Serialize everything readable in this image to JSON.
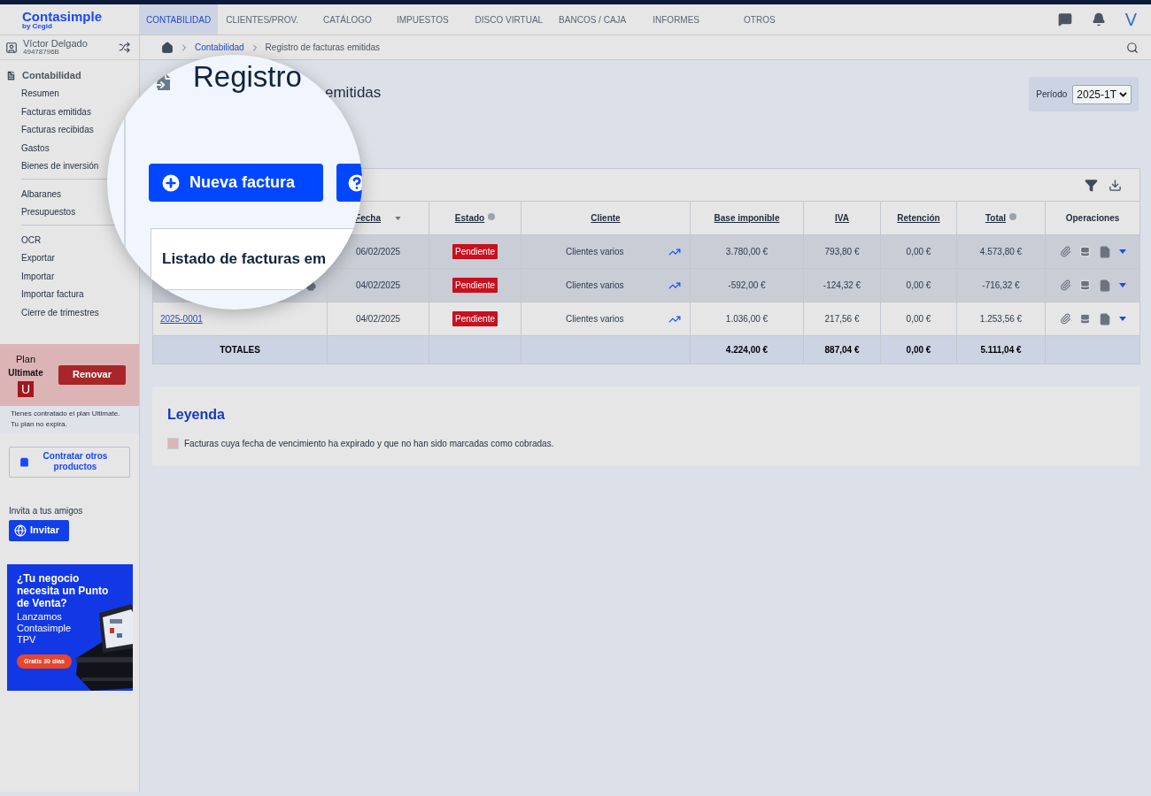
{
  "app": {
    "logo": "Contasimple",
    "logo_sub": "by Cegid",
    "user_initial": "V"
  },
  "nav": [
    {
      "label": "CONTABILIDAD",
      "selected": true
    },
    {
      "label": "CLIENTES/PROV.",
      "selected": false
    },
    {
      "label": "CATÁLOGO",
      "selected": false
    },
    {
      "label": "IMPUESTOS",
      "selected": false
    },
    {
      "label": "DISCO VIRTUAL",
      "selected": false
    },
    {
      "label": "BANCOS / CAJA",
      "selected": false
    },
    {
      "label": "INFORMES",
      "selected": false
    },
    {
      "label": "OTROS",
      "selected": false
    }
  ],
  "user": {
    "name": "Víctor Delgado",
    "id": "49478796B"
  },
  "breadcrumb": [
    "Contabilidad",
    "Registro de facturas emitidas"
  ],
  "sidebar": {
    "section": "Contabilidad",
    "groups": [
      [
        "Resumen",
        "Facturas emitidas",
        "Facturas recibidas",
        "Gastos",
        "Bienes de inversión"
      ],
      [
        "Albaranes",
        "Presupuestos"
      ],
      [
        "OCR",
        "Exportar",
        "Importar",
        "Importar factura",
        "Cierre de trimestres"
      ]
    ]
  },
  "plan": {
    "label": "Plan",
    "name": "Ultimate",
    "badge": "U",
    "button": "Renovar",
    "note": [
      "Tienes contratado el plan Ultimate.",
      "Tu plan no expira."
    ]
  },
  "other_products_button": "Contratar otros productos",
  "invite": {
    "label": "Invita a tus amigos",
    "button": "Invitar"
  },
  "promo": {
    "headline": "¿Tu negocio necesita un Punto de Venta?",
    "text": "Lanzamos Contasimple TPV",
    "badge": "Gratis 30 días"
  },
  "page": {
    "title_visible": "emitidas",
    "period_label": "Período",
    "period_value": "2025-1T"
  },
  "magnifier": {
    "title": "Registro",
    "button": "Nueva factura",
    "card_title": "Listado de facturas em"
  },
  "table": {
    "columns": [
      {
        "label": "Fecha",
        "kind": "sort"
      },
      {
        "label": "Estado",
        "kind": "info"
      },
      {
        "label": "Cliente",
        "kind": "link"
      },
      {
        "label": "Base imponible",
        "kind": "link"
      },
      {
        "label": "IVA",
        "kind": "link"
      },
      {
        "label": "Retención",
        "kind": "link"
      },
      {
        "label": "Total",
        "kind": "info"
      },
      {
        "label": "Operaciones",
        "kind": "plain"
      }
    ],
    "rows": [
      {
        "date": "06/02/2025",
        "status": "Pendiente",
        "client": "Clientes varios",
        "base": "3.780,00 €",
        "iva": "793,80 €",
        "retention": "0,00 €",
        "total": "4.573,80 €",
        "overdue": true,
        "note": false
      },
      {
        "date": "04/02/2025",
        "status": "Pendiente",
        "client": "Clientes varios",
        "base": "-592,00 €",
        "iva": "-124,32 €",
        "retention": "0,00 €",
        "total": "-716,32 €",
        "overdue": true,
        "note": true
      },
      {
        "number": "2025-0001",
        "date": "04/02/2025",
        "status": "Pendiente",
        "client": "Clientes varios",
        "base": "1.036,00 €",
        "iva": "217,56 €",
        "retention": "0,00 €",
        "total": "1.253,56 €",
        "overdue": false,
        "note": false
      }
    ],
    "totals": {
      "label": "TOTALES",
      "base": "4.224,00 €",
      "iva": "887,04 €",
      "retention": "0,00 €",
      "total": "5.111,04 €"
    }
  },
  "legend": {
    "title": "Leyenda",
    "items": [
      {
        "text": "Facturas cuya fecha de vencimiento ha expirado y que no han sido marcadas como cobradas.",
        "color": "#dcb4bc"
      }
    ]
  }
}
